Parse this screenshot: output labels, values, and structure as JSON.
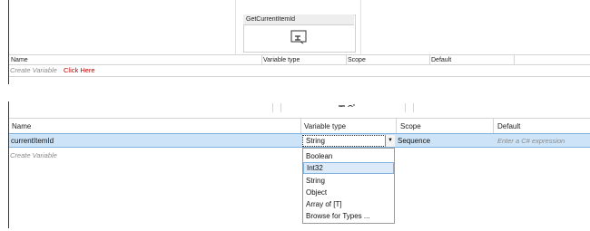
{
  "top_panel": {
    "activity_title": "GetCurrentItemId",
    "activity_icon": "assign-icon",
    "columns": [
      "Name",
      "Variable type",
      "Scope",
      "Default"
    ],
    "create_variable": "Create Variable",
    "click_here": "Click Here",
    "click_here_color": "#c00000"
  },
  "bottom_panel": {
    "columns": [
      "Name",
      "Variable type",
      "Scope",
      "Default"
    ],
    "row": {
      "name": "currentItemId",
      "type": "String",
      "scope": "Sequence",
      "default_placeholder": "Enter a C# expression"
    },
    "create_variable": "Create Variable",
    "type_options": [
      "Boolean",
      "Int32",
      "String",
      "Object",
      "Array of [T]",
      "Browse for Types ..."
    ],
    "highlighted_option": "Int32",
    "selection_color": "#cde3f7"
  }
}
